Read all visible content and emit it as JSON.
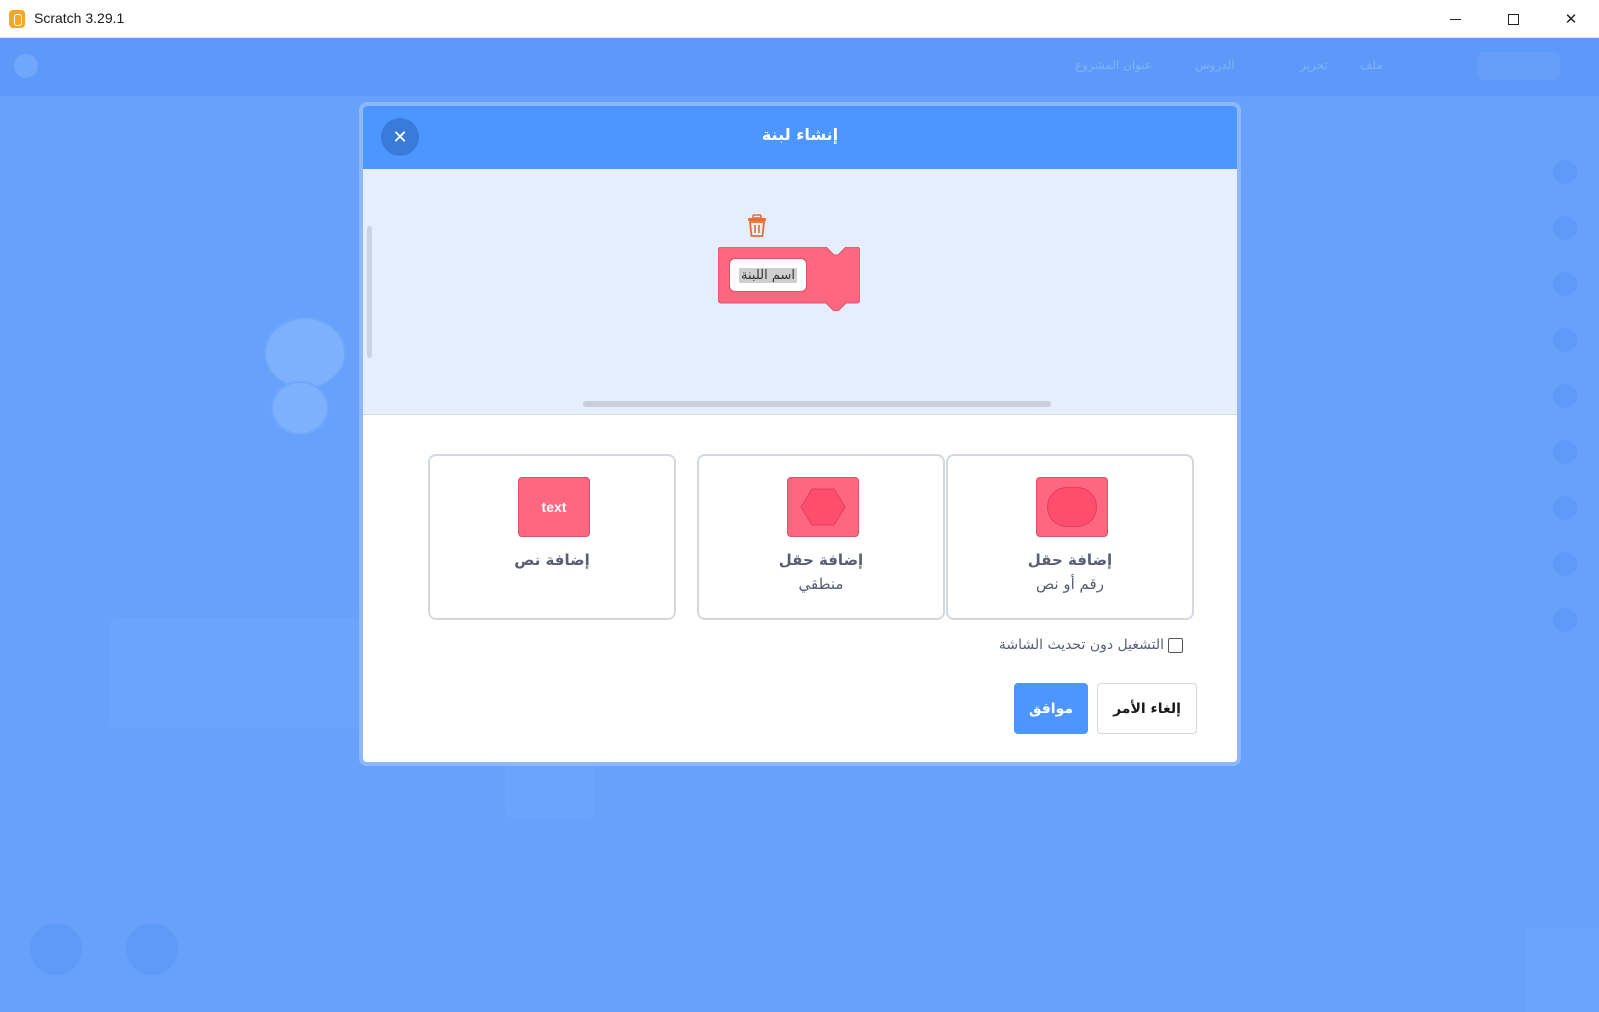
{
  "window": {
    "title": "Scratch 3.29.1"
  },
  "background": {
    "menu_items": [
      "تحرير",
      "ملف",
      "الدروس",
      "عنوان المشروع"
    ]
  },
  "dialog": {
    "title": "إنشاء لبنة",
    "block_name": "اسم اللبنة",
    "options": [
      {
        "label": "إضافة نص",
        "sublabel": "",
        "icon_text": "text"
      },
      {
        "label": "إضافة حقل",
        "sublabel": "منطقي",
        "icon_text": ""
      },
      {
        "label": "إضافة حقل",
        "sublabel": "رقم أو نص",
        "icon_text": ""
      }
    ],
    "checkbox_label": "التشغيل دون تحديث الشاشة",
    "ok_label": "موافق",
    "cancel_label": "إلغاء الأمر"
  },
  "colors": {
    "accent": "#4c97ff",
    "block": "#ff6680"
  }
}
